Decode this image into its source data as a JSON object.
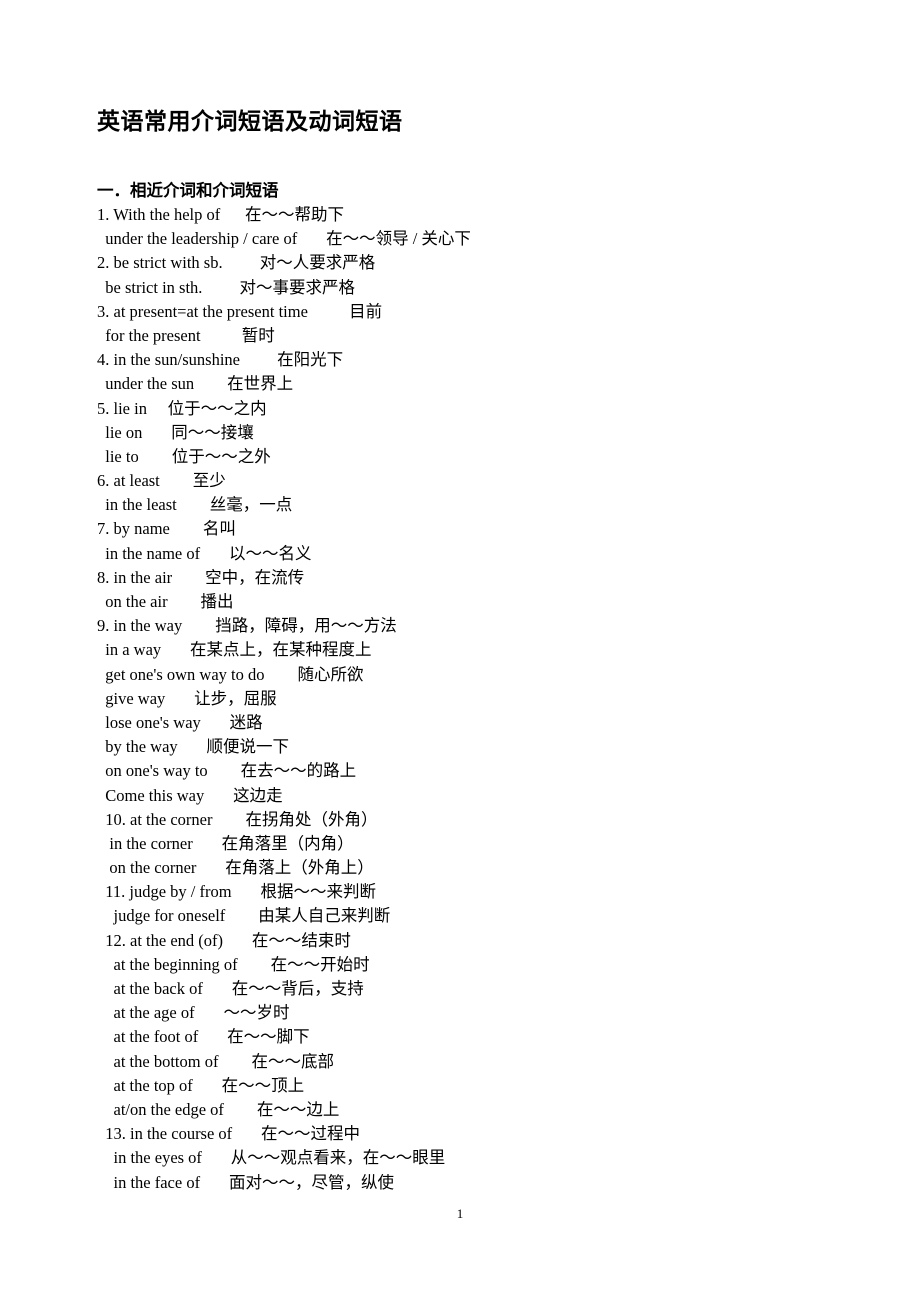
{
  "document": {
    "title": "英语常用介词短语及动词短语",
    "section_heading": "一．相近介词和介词短语",
    "page_number": "1",
    "lines": [
      "1. With the help of      在～～帮助下",
      "  under the leadership / care of       在～～领导 / 关心下",
      "2. be strict with sb.         对～人要求严格",
      "  be strict in sth.         对～事要求严格",
      "3. at present=at the present time          目前",
      "  for the present          暂时",
      "4. in the sun/sunshine         在阳光下",
      "  under the sun        在世界上",
      "5. lie in     位于～～之内",
      "  lie on       同～～接壤",
      "  lie to        位于～～之外",
      "6. at least        至少",
      "  in the least        丝毫，一点",
      "7. by name        名叫",
      "  in the name of       以～～名义",
      "8. in the air        空中，在流传",
      "  on the air        播出",
      "9. in the way        挡路，障碍，用～～方法",
      "  in a way       在某点上，在某种程度上",
      "  get one's own way to do        随心所欲",
      "  give way       让步，屈服",
      "  lose one's way       迷路",
      "  by the way       顺便说一下",
      "  on one's way to        在去～～的路上",
      "  Come this way       这边走",
      "  10. at the corner        在拐角处（外角）",
      "   in the corner       在角落里（内角）",
      "   on the corner       在角落上（外角上）",
      "  11. judge by / from       根据～～来判断",
      "    judge for oneself        由某人自己来判断",
      "  12. at the end (of)       在～～结束时",
      "    at the beginning of        在～～开始时",
      "    at the back of       在～～背后，支持",
      "    at the age of       ～～岁时",
      "    at the foot of       在～～脚下",
      "    at the bottom of        在～～底部",
      "    at the top of       在～～顶上",
      "    at/on the edge of        在～～边上",
      "  13. in the course of       在～～过程中",
      "    in the eyes of       从～～观点看来，在～～眼里",
      "    in the face of       面对～～，尽管，纵使"
    ]
  }
}
